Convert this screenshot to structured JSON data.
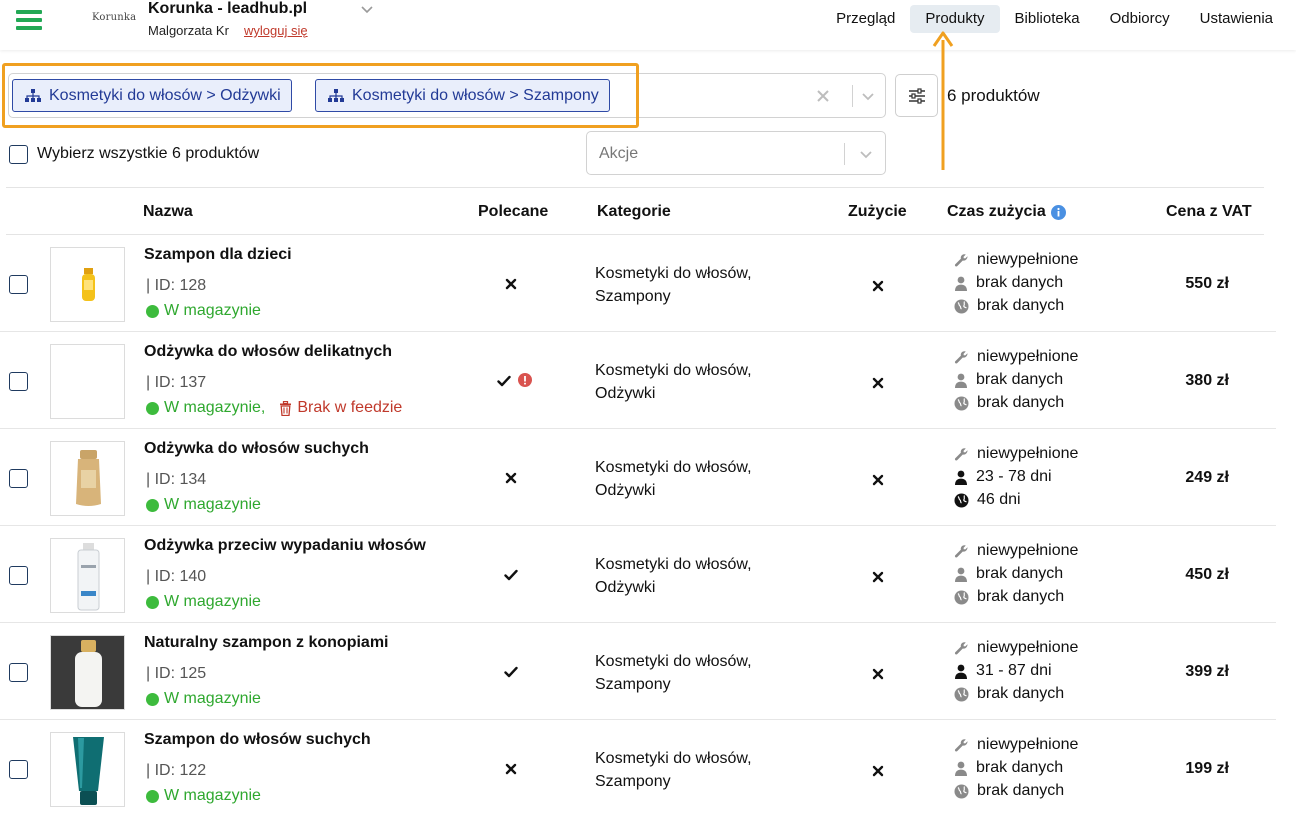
{
  "header": {
    "logo_text": "Korunka",
    "shop_title": "Korunka - leadhub.pl",
    "user_name": "Malgorzata Kr",
    "logout_label": "wyloguj się",
    "nav": [
      {
        "label": "Przegląd",
        "active": false
      },
      {
        "label": "Produkty",
        "active": true
      },
      {
        "label": "Biblioteka",
        "active": false
      },
      {
        "label": "Odbiorcy",
        "active": false
      },
      {
        "label": "Ustawienia",
        "active": false
      }
    ]
  },
  "filters": {
    "chips": [
      {
        "label": "Kosmetyki do włosów > Odżywki"
      },
      {
        "label": "Kosmetyki do włosów > Szampony"
      }
    ],
    "product_count": "6 produktów"
  },
  "selection": {
    "select_all_label": "Wybierz wszystkie 6 produktów",
    "actions_placeholder": "Akcje"
  },
  "table": {
    "columns": {
      "name": "Nazwa",
      "recommended": "Polecane",
      "categories": "Kategorie",
      "consumption": "Zużycie",
      "consumption_time": "Czas zużycia",
      "price": "Cena z VAT"
    },
    "rows": [
      {
        "name": "Szampon dla dzieci",
        "id": "| ID: 128",
        "stock": "W magazynie",
        "feed": "",
        "recommended": "no",
        "categories_1": "Kosmetyki do włosów,",
        "categories_2": "Szampony",
        "consumption": "no",
        "time_1": "niewypełnione",
        "time_2": "brak danych",
        "time_3": "brak danych",
        "price": "550 zł",
        "thumb": "yellow-bottle"
      },
      {
        "name": "Odżywka do włosów delikatnych",
        "id": "| ID: 137",
        "stock": "W magazynie",
        "feed": "Brak w feedzie",
        "recommended": "yes-warning",
        "categories_1": "Kosmetyki do włosów,",
        "categories_2": "Odżywki",
        "consumption": "no",
        "time_1": "niewypełnione",
        "time_2": "brak danych",
        "time_3": "brak danych",
        "price": "380 zł",
        "thumb": "empty"
      },
      {
        "name": "Odżywka do włosów suchych",
        "id": "| ID: 134",
        "stock": "W magazynie",
        "feed": "",
        "recommended": "no",
        "categories_1": "Kosmetyki do włosów,",
        "categories_2": "Odżywki",
        "consumption": "no",
        "time_1": "niewypełnione",
        "time_2": "23 - 78 dni",
        "time_3": "46 dni",
        "price": "249 zł",
        "thumb": "gold-bottle"
      },
      {
        "name": "Odżywka przeciw wypadaniu włosów",
        "id": "| ID: 140",
        "stock": "W magazynie",
        "feed": "",
        "recommended": "yes",
        "categories_1": "Kosmetyki do włosów,",
        "categories_2": "Odżywki",
        "consumption": "no",
        "time_1": "niewypełnione",
        "time_2": "brak danych",
        "time_3": "brak danych",
        "price": "450 zł",
        "thumb": "white-bottle"
      },
      {
        "name": "Naturalny szampon z konopiami",
        "id": "| ID: 125",
        "stock": "W magazynie",
        "feed": "",
        "recommended": "yes",
        "categories_1": "Kosmetyki do włosów,",
        "categories_2": "Szampony",
        "consumption": "no",
        "time_1": "niewypełnione",
        "time_2": "31 - 87 dni",
        "time_3": "brak danych",
        "price": "399 zł",
        "thumb": "white-dark-bottle"
      },
      {
        "name": "Szampon do włosów suchych",
        "id": "| ID: 122",
        "stock": "W magazynie",
        "feed": "",
        "recommended": "no",
        "categories_1": "Kosmetyki do włosów,",
        "categories_2": "Szampony",
        "consumption": "no",
        "time_1": "niewypełnione",
        "time_2": "brak danych",
        "time_3": "brak danych",
        "price": "199 zł",
        "thumb": "teal-tube"
      }
    ]
  },
  "colors": {
    "accent_green": "#22a855",
    "chip_blue": "#223a96",
    "highlight_orange": "#f0a020",
    "stock_green": "#2fa82f",
    "warning_red": "#c0392b"
  }
}
